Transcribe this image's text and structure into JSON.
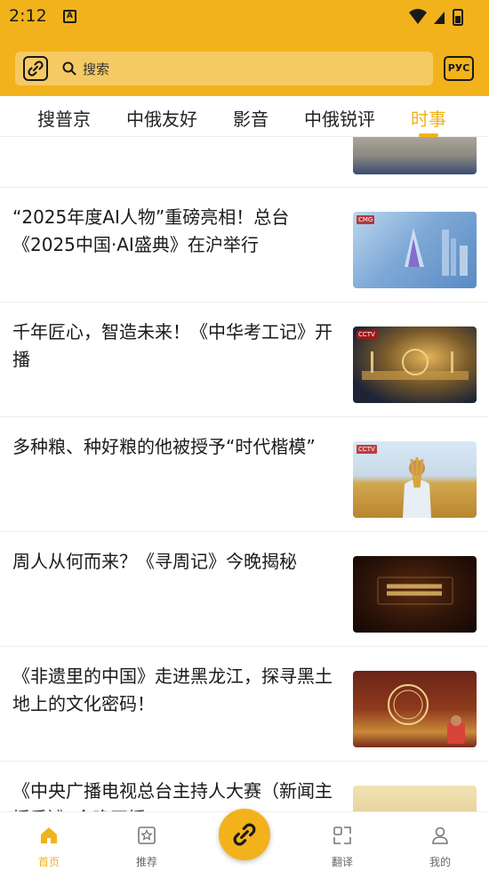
{
  "status_bar": {
    "time": "2:12",
    "notification_letter": "A"
  },
  "header": {
    "search_placeholder": "搜索",
    "language_button": "РУС"
  },
  "tabs": [
    {
      "label": "搜普京",
      "active": false
    },
    {
      "label": "中俄友好",
      "active": false
    },
    {
      "label": "影音",
      "active": false
    },
    {
      "label": "中俄锐评",
      "active": false
    },
    {
      "label": "时事",
      "active": true
    }
  ],
  "feed": {
    "items": [
      {
        "title": "“2025年度AI人物”重磅亮相！总台《2025中国·AI盛典》在沪举行"
      },
      {
        "title": "千年匠心，智造未来！《中华考工记》开播"
      },
      {
        "title": "多种粮、种好粮的他被授予“时代楷模”"
      },
      {
        "title": "周人从何而来？《寻周记》今晚揭秘"
      },
      {
        "title": "《非遗里的中国》走进黑龙江，探寻黑土地上的文化密码！"
      },
      {
        "title": "《中央广播电视总台主持人大赛（新闻主播秀）》今晚开播"
      }
    ]
  },
  "bottom_nav": [
    {
      "label": "首页",
      "icon": "home-icon",
      "active": true
    },
    {
      "label": "推荐",
      "icon": "star-badge-icon",
      "active": false
    },
    {
      "label": "翻译",
      "icon": "translate-scan-icon",
      "active": false
    },
    {
      "label": "我的",
      "icon": "person-icon",
      "active": false
    }
  ],
  "colors": {
    "accent": "#f2b21b",
    "text": "#1a1a1a"
  }
}
